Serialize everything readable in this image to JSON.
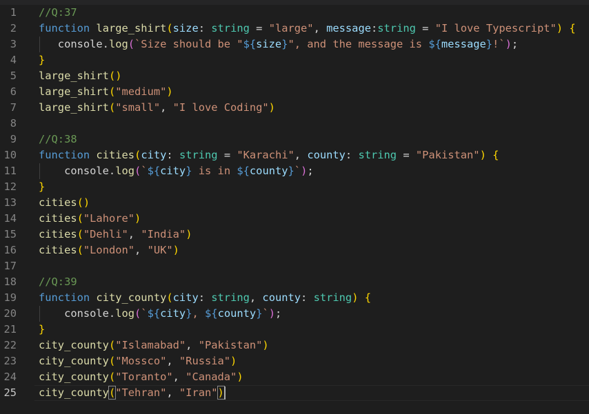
{
  "editor": {
    "active_line": 25,
    "lines": [
      {
        "n": "1",
        "tokens": [
          {
            "t": "//Q:37",
            "c": "comment"
          }
        ]
      },
      {
        "n": "2",
        "tokens": [
          {
            "t": "function",
            "c": "keyword"
          },
          {
            "t": " ",
            "c": "plain"
          },
          {
            "t": "large_shirt",
            "c": "func"
          },
          {
            "t": "(",
            "c": "brace1"
          },
          {
            "t": "size",
            "c": "param"
          },
          {
            "t": ": ",
            "c": "plain"
          },
          {
            "t": "string",
            "c": "type"
          },
          {
            "t": " = ",
            "c": "plain"
          },
          {
            "t": "\"large\"",
            "c": "string"
          },
          {
            "t": ", ",
            "c": "plain"
          },
          {
            "t": "message",
            "c": "param"
          },
          {
            "t": ":",
            "c": "plain"
          },
          {
            "t": "string",
            "c": "type"
          },
          {
            "t": " = ",
            "c": "plain"
          },
          {
            "t": "\"I love Typescript\"",
            "c": "string"
          },
          {
            "t": ")",
            "c": "brace1"
          },
          {
            "t": " ",
            "c": "plain"
          },
          {
            "t": "{",
            "c": "brace1"
          }
        ]
      },
      {
        "n": "3",
        "tokens": [
          {
            "t": "   console.",
            "c": "plain"
          },
          {
            "t": "log",
            "c": "func"
          },
          {
            "t": "(",
            "c": "brace2"
          },
          {
            "t": "`Size should be \"",
            "c": "string"
          },
          {
            "t": "${",
            "c": "tmpl"
          },
          {
            "t": "size",
            "c": "param"
          },
          {
            "t": "}",
            "c": "tmpl"
          },
          {
            "t": "\", and the message is ",
            "c": "string"
          },
          {
            "t": "${",
            "c": "tmpl"
          },
          {
            "t": "message",
            "c": "param"
          },
          {
            "t": "}",
            "c": "tmpl"
          },
          {
            "t": "!`",
            "c": "string"
          },
          {
            "t": ")",
            "c": "brace2"
          },
          {
            "t": ";",
            "c": "plain"
          }
        ]
      },
      {
        "n": "4",
        "tokens": [
          {
            "t": "}",
            "c": "brace1"
          }
        ]
      },
      {
        "n": "5",
        "tokens": [
          {
            "t": "large_shirt",
            "c": "func"
          },
          {
            "t": "()",
            "c": "brace1"
          }
        ]
      },
      {
        "n": "6",
        "tokens": [
          {
            "t": "large_shirt",
            "c": "func"
          },
          {
            "t": "(",
            "c": "brace1"
          },
          {
            "t": "\"medium\"",
            "c": "string"
          },
          {
            "t": ")",
            "c": "brace1"
          }
        ]
      },
      {
        "n": "7",
        "tokens": [
          {
            "t": "large_shirt",
            "c": "func"
          },
          {
            "t": "(",
            "c": "brace1"
          },
          {
            "t": "\"small\"",
            "c": "string"
          },
          {
            "t": ", ",
            "c": "plain"
          },
          {
            "t": "\"I love Coding\"",
            "c": "string"
          },
          {
            "t": ")",
            "c": "brace1"
          }
        ]
      },
      {
        "n": "8",
        "tokens": []
      },
      {
        "n": "9",
        "tokens": [
          {
            "t": "//Q:38",
            "c": "comment"
          }
        ]
      },
      {
        "n": "10",
        "tokens": [
          {
            "t": "function",
            "c": "keyword"
          },
          {
            "t": " ",
            "c": "plain"
          },
          {
            "t": "cities",
            "c": "func"
          },
          {
            "t": "(",
            "c": "brace1"
          },
          {
            "t": "city",
            "c": "param"
          },
          {
            "t": ": ",
            "c": "plain"
          },
          {
            "t": "string",
            "c": "type"
          },
          {
            "t": " = ",
            "c": "plain"
          },
          {
            "t": "\"Karachi\"",
            "c": "string"
          },
          {
            "t": ", ",
            "c": "plain"
          },
          {
            "t": "county",
            "c": "param"
          },
          {
            "t": ": ",
            "c": "plain"
          },
          {
            "t": "string",
            "c": "type"
          },
          {
            "t": " = ",
            "c": "plain"
          },
          {
            "t": "\"Pakistan\"",
            "c": "string"
          },
          {
            "t": ")",
            "c": "brace1"
          },
          {
            "t": " ",
            "c": "plain"
          },
          {
            "t": "{",
            "c": "brace1"
          }
        ]
      },
      {
        "n": "11",
        "tokens": [
          {
            "t": "    console.",
            "c": "plain"
          },
          {
            "t": "log",
            "c": "func"
          },
          {
            "t": "(",
            "c": "brace2"
          },
          {
            "t": "`",
            "c": "string"
          },
          {
            "t": "${",
            "c": "tmpl"
          },
          {
            "t": "city",
            "c": "param"
          },
          {
            "t": "}",
            "c": "tmpl"
          },
          {
            "t": " is in ",
            "c": "string"
          },
          {
            "t": "${",
            "c": "tmpl"
          },
          {
            "t": "county",
            "c": "param"
          },
          {
            "t": "}",
            "c": "tmpl"
          },
          {
            "t": "`",
            "c": "string"
          },
          {
            "t": ")",
            "c": "brace2"
          },
          {
            "t": ";",
            "c": "plain"
          }
        ]
      },
      {
        "n": "12",
        "tokens": [
          {
            "t": "}",
            "c": "brace1"
          }
        ]
      },
      {
        "n": "13",
        "tokens": [
          {
            "t": "cities",
            "c": "func"
          },
          {
            "t": "()",
            "c": "brace1"
          }
        ]
      },
      {
        "n": "14",
        "tokens": [
          {
            "t": "cities",
            "c": "func"
          },
          {
            "t": "(",
            "c": "brace1"
          },
          {
            "t": "\"Lahore\"",
            "c": "string"
          },
          {
            "t": ")",
            "c": "brace1"
          }
        ]
      },
      {
        "n": "15",
        "tokens": [
          {
            "t": "cities",
            "c": "func"
          },
          {
            "t": "(",
            "c": "brace1"
          },
          {
            "t": "\"Dehli\"",
            "c": "string"
          },
          {
            "t": ", ",
            "c": "plain"
          },
          {
            "t": "\"India\"",
            "c": "string"
          },
          {
            "t": ")",
            "c": "brace1"
          }
        ]
      },
      {
        "n": "16",
        "tokens": [
          {
            "t": "cities",
            "c": "func"
          },
          {
            "t": "(",
            "c": "brace1"
          },
          {
            "t": "\"London\"",
            "c": "string"
          },
          {
            "t": ", ",
            "c": "plain"
          },
          {
            "t": "\"UK\"",
            "c": "string"
          },
          {
            "t": ")",
            "c": "brace1"
          }
        ]
      },
      {
        "n": "17",
        "tokens": []
      },
      {
        "n": "18",
        "tokens": [
          {
            "t": "//Q:39",
            "c": "comment"
          }
        ]
      },
      {
        "n": "19",
        "tokens": [
          {
            "t": "function",
            "c": "keyword"
          },
          {
            "t": " ",
            "c": "plain"
          },
          {
            "t": "city_county",
            "c": "func"
          },
          {
            "t": "(",
            "c": "brace1"
          },
          {
            "t": "city",
            "c": "param"
          },
          {
            "t": ": ",
            "c": "plain"
          },
          {
            "t": "string",
            "c": "type"
          },
          {
            "t": ", ",
            "c": "plain"
          },
          {
            "t": "county",
            "c": "param"
          },
          {
            "t": ": ",
            "c": "plain"
          },
          {
            "t": "string",
            "c": "type"
          },
          {
            "t": ")",
            "c": "brace1"
          },
          {
            "t": " ",
            "c": "plain"
          },
          {
            "t": "{",
            "c": "brace1"
          }
        ]
      },
      {
        "n": "20",
        "tokens": [
          {
            "t": "    console.",
            "c": "plain"
          },
          {
            "t": "log",
            "c": "func"
          },
          {
            "t": "(",
            "c": "brace2"
          },
          {
            "t": "`",
            "c": "string"
          },
          {
            "t": "${",
            "c": "tmpl"
          },
          {
            "t": "city",
            "c": "param"
          },
          {
            "t": "}",
            "c": "tmpl"
          },
          {
            "t": ", ",
            "c": "string"
          },
          {
            "t": "${",
            "c": "tmpl"
          },
          {
            "t": "county",
            "c": "param"
          },
          {
            "t": "}",
            "c": "tmpl"
          },
          {
            "t": "`",
            "c": "string"
          },
          {
            "t": ")",
            "c": "brace2"
          },
          {
            "t": ";",
            "c": "plain"
          }
        ]
      },
      {
        "n": "21",
        "tokens": [
          {
            "t": "}",
            "c": "brace1"
          }
        ]
      },
      {
        "n": "22",
        "tokens": [
          {
            "t": "city_county",
            "c": "func"
          },
          {
            "t": "(",
            "c": "brace1"
          },
          {
            "t": "\"Islamabad\"",
            "c": "string"
          },
          {
            "t": ", ",
            "c": "plain"
          },
          {
            "t": "\"Pakistan\"",
            "c": "string"
          },
          {
            "t": ")",
            "c": "brace1"
          }
        ]
      },
      {
        "n": "23",
        "tokens": [
          {
            "t": "city_county",
            "c": "func"
          },
          {
            "t": "(",
            "c": "brace1"
          },
          {
            "t": "\"Mossco\"",
            "c": "string"
          },
          {
            "t": ", ",
            "c": "plain"
          },
          {
            "t": "\"Russia\"",
            "c": "string"
          },
          {
            "t": ")",
            "c": "brace1"
          }
        ]
      },
      {
        "n": "24",
        "tokens": [
          {
            "t": "city_county",
            "c": "func"
          },
          {
            "t": "(",
            "c": "brace1"
          },
          {
            "t": "\"Toranto\"",
            "c": "string"
          },
          {
            "t": ", ",
            "c": "plain"
          },
          {
            "t": "\"Canada\"",
            "c": "string"
          },
          {
            "t": ")",
            "c": "brace1"
          }
        ]
      },
      {
        "n": "25",
        "tokens": [
          {
            "t": "city_county",
            "c": "func"
          },
          {
            "t": "(",
            "c": "brace1",
            "m": 1
          },
          {
            "t": "\"Tehran\"",
            "c": "string"
          },
          {
            "t": ", ",
            "c": "plain"
          },
          {
            "t": "\"Iran\"",
            "c": "string"
          },
          {
            "t": ")",
            "c": "brace1",
            "m": 1
          }
        ]
      }
    ]
  }
}
